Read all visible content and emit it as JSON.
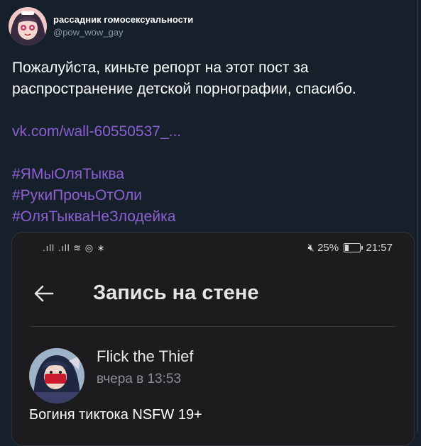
{
  "author": {
    "display_name": "рассадник гомосексуальности",
    "handle": "@pow_wow_gay"
  },
  "tweet": {
    "text": "Пожалуйста, киньте репорт на этот пост за распространение детской порнографии, спасибо.",
    "link": "vk.com/wall-60550537_...",
    "hashtags": [
      "#ЯМыОляТыква",
      "#РукиПрочьОтОли",
      "#ОляТыкваНеЗлодейка"
    ]
  },
  "media": {
    "status_bar": {
      "signal": ".ıll .ıll ≋ ◎ ∗",
      "mute_icon": "mute-icon",
      "battery": "25%",
      "time": "21:57"
    },
    "screen_title": "Запись на стене",
    "back_icon": "back-arrow-icon",
    "post": {
      "author": "Flick the Thief",
      "time": "вчера в 13:53",
      "text": "Богиня тиктока NSFW 19+"
    }
  },
  "colors": {
    "background": "#15202b",
    "link": "#8d5fd3",
    "secondary_text": "#8899a6",
    "screenshot_bg": "#1c1c1e"
  }
}
